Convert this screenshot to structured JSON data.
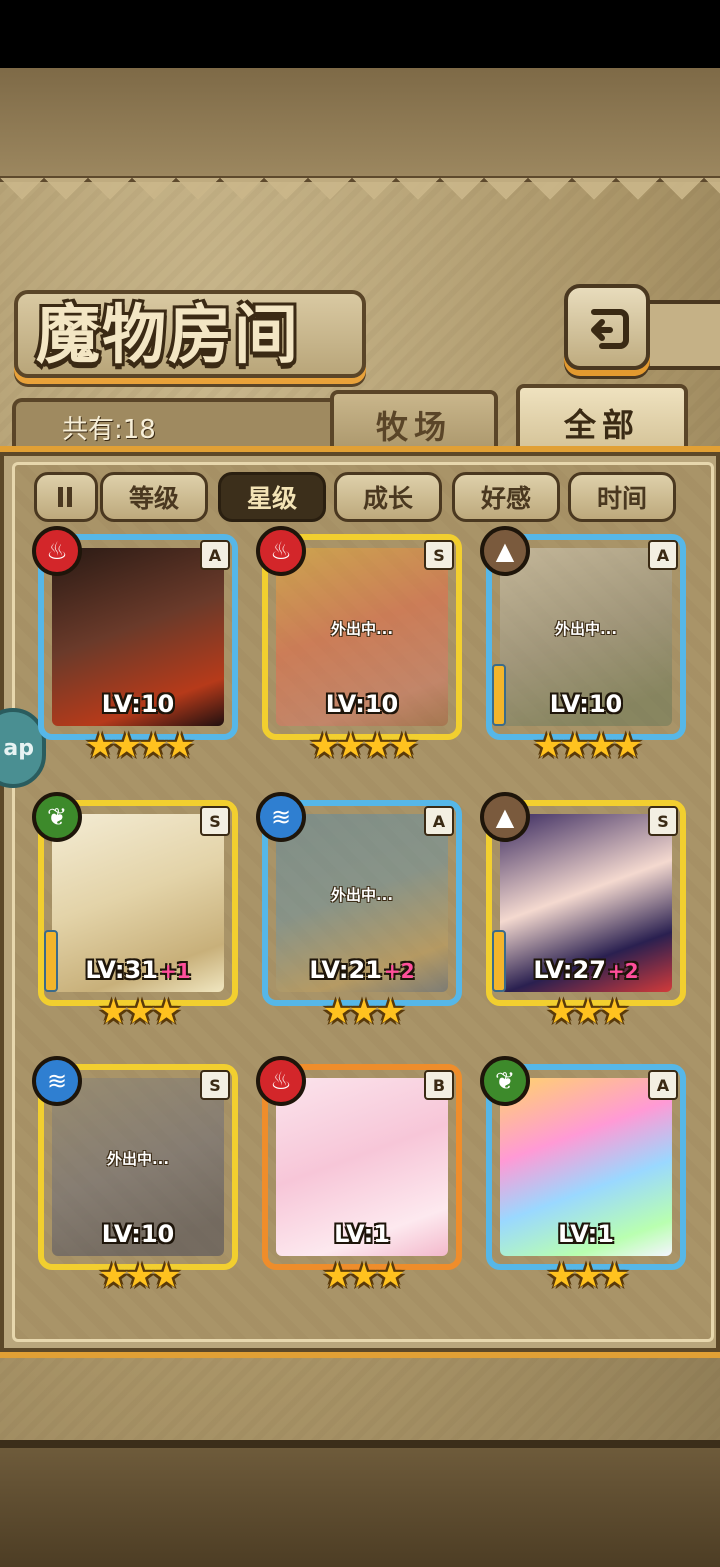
{
  "title": "魔物房间",
  "count_label": "共有:18",
  "tabs": [
    {
      "label": "牧场",
      "active": false
    },
    {
      "label": "全部",
      "active": true
    }
  ],
  "sort_toggle_icon": "pause-icon",
  "filters": [
    {
      "label": "等级",
      "active": false
    },
    {
      "label": "星级",
      "active": true
    },
    {
      "label": "成长",
      "active": false
    },
    {
      "label": "好感",
      "active": false
    },
    {
      "label": "时间",
      "active": false
    }
  ],
  "side_bubble": "ap",
  "colors": {
    "fire": "#d3262a",
    "earth": "#7a5a3d",
    "grass": "#3d8a2b",
    "water": "#2f7fd1",
    "frame_blue": "#56b7e8",
    "frame_gold": "#f2cf2f",
    "frame_orange": "#ef8d2b"
  },
  "monsters": [
    {
      "element": "fire-icon",
      "rank": "A",
      "level": "LV:10",
      "bonus": "",
      "stars": "★★★★",
      "away": "",
      "frame": "blue"
    },
    {
      "element": "fire-icon",
      "rank": "S",
      "level": "LV:10",
      "bonus": "",
      "stars": "★★★★",
      "away": "外出中...",
      "frame": "gold"
    },
    {
      "element": "earth-icon",
      "rank": "A",
      "level": "LV:10",
      "bonus": "",
      "stars": "★★★★",
      "away": "外出中...",
      "frame": "blue"
    },
    {
      "element": "grass-icon",
      "rank": "S",
      "level": "LV:31",
      "bonus": "+1",
      "stars": "★★★",
      "away": "",
      "frame": "gold"
    },
    {
      "element": "water-icon",
      "rank": "A",
      "level": "LV:21",
      "bonus": "+2",
      "stars": "★★★",
      "away": "外出中...",
      "frame": "blue"
    },
    {
      "element": "earth-icon",
      "rank": "S",
      "level": "LV:27",
      "bonus": "+2",
      "stars": "★★★",
      "away": "",
      "frame": "gold"
    },
    {
      "element": "water-icon",
      "rank": "S",
      "level": "LV:10",
      "bonus": "",
      "stars": "★★★",
      "away": "外出中...",
      "frame": "gold"
    },
    {
      "element": "fire-icon",
      "rank": "B",
      "level": "LV:1",
      "bonus": "",
      "stars": "★★★",
      "away": "",
      "frame": "orange"
    },
    {
      "element": "grass-icon",
      "rank": "A",
      "level": "LV:1",
      "bonus": "",
      "stars": "★★★",
      "away": "",
      "frame": "blue"
    }
  ]
}
